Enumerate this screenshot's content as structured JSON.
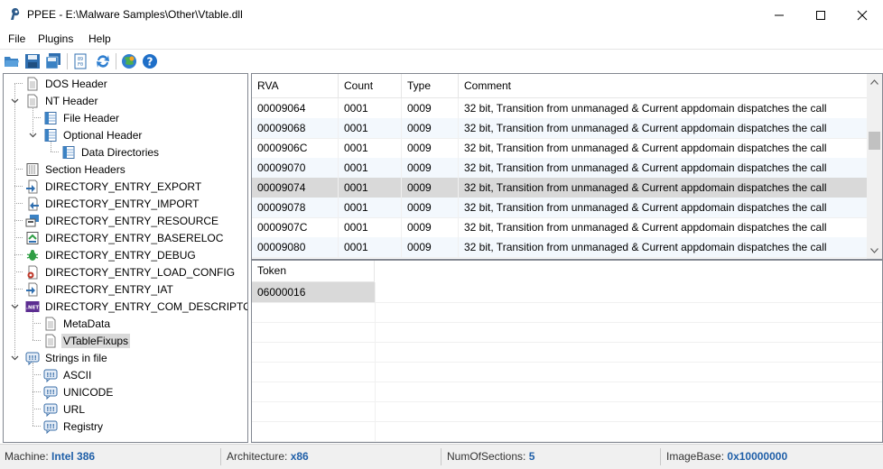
{
  "window": {
    "title": "PPEE - E:\\Malware Samples\\Other\\Vtable.dll",
    "minimize_icon": "minimize-icon",
    "maximize_icon": "maximize-icon",
    "close_icon": "close-icon"
  },
  "menu": [
    "File",
    "Plugins",
    "Help"
  ],
  "toolbar": {
    "icons": [
      "open-folder-icon",
      "save-icon",
      "save-all-icon",
      "hex-view-icon",
      "refresh-icon",
      "virustotal-icon",
      "help-icon"
    ]
  },
  "tree": {
    "nodes": [
      {
        "label": "DOS Header",
        "icon": "document-icon"
      },
      {
        "label": "NT Header",
        "icon": "document-icon"
      },
      {
        "label": "File Header",
        "icon": "table-icon"
      },
      {
        "label": "Optional Header",
        "icon": "table-icon"
      },
      {
        "label": "Data Directories",
        "icon": "table-icon"
      },
      {
        "label": "Section Headers",
        "icon": "sections-icon"
      },
      {
        "label": "DIRECTORY_ENTRY_EXPORT",
        "icon": "export-icon"
      },
      {
        "label": "DIRECTORY_ENTRY_IMPORT",
        "icon": "import-icon"
      },
      {
        "label": "DIRECTORY_ENTRY_RESOURCE",
        "icon": "resource-icon"
      },
      {
        "label": "DIRECTORY_ENTRY_BASERELOC",
        "icon": "reloc-icon"
      },
      {
        "label": "DIRECTORY_ENTRY_DEBUG",
        "icon": "bug-icon"
      },
      {
        "label": "DIRECTORY_ENTRY_LOAD_CONFIG",
        "icon": "config-icon"
      },
      {
        "label": "DIRECTORY_ENTRY_IAT",
        "icon": "iat-icon"
      },
      {
        "label": "DIRECTORY_ENTRY_COM_DESCRIPTOR",
        "icon": "dotnet-icon"
      },
      {
        "label": "MetaData",
        "icon": "document-icon"
      },
      {
        "label": "VTableFixups",
        "icon": "document-icon"
      },
      {
        "label": "Strings in file",
        "icon": "strings-icon"
      },
      {
        "label": "ASCII",
        "icon": "strings-icon"
      },
      {
        "label": "UNICODE",
        "icon": "strings-icon"
      },
      {
        "label": "URL",
        "icon": "strings-icon"
      },
      {
        "label": "Registry",
        "icon": "strings-icon"
      }
    ],
    "net_badge": ".NET"
  },
  "grid": {
    "columns": [
      "RVA",
      "Count",
      "Type",
      "Comment"
    ],
    "rows": [
      [
        "00009064",
        "0001",
        "0009",
        "32 bit, Transition from unmanaged & Current appdomain dispatches the call"
      ],
      [
        "00009068",
        "0001",
        "0009",
        "32 bit, Transition from unmanaged & Current appdomain dispatches the call"
      ],
      [
        "0000906C",
        "0001",
        "0009",
        "32 bit, Transition from unmanaged & Current appdomain dispatches the call"
      ],
      [
        "00009070",
        "0001",
        "0009",
        "32 bit, Transition from unmanaged & Current appdomain dispatches the call"
      ],
      [
        "00009074",
        "0001",
        "0009",
        "32 bit, Transition from unmanaged & Current appdomain dispatches the call"
      ],
      [
        "00009078",
        "0001",
        "0009",
        "32 bit, Transition from unmanaged & Current appdomain dispatches the call"
      ],
      [
        "0000907C",
        "0001",
        "0009",
        "32 bit, Transition from unmanaged & Current appdomain dispatches the call"
      ],
      [
        "00009080",
        "0001",
        "0009",
        "32 bit, Transition from unmanaged & Current appdomain dispatches the call"
      ]
    ]
  },
  "token_grid": {
    "header": "Token",
    "rows": [
      "06000016"
    ]
  },
  "status": {
    "machine_label": "Machine:",
    "machine_value": "Intel 386",
    "arch_label": "Architecture:",
    "arch_value": "x86",
    "sections_label": "NumOfSections:",
    "sections_value": "5",
    "imagebase_label": "ImageBase:",
    "imagebase_value": "0x10000000"
  }
}
